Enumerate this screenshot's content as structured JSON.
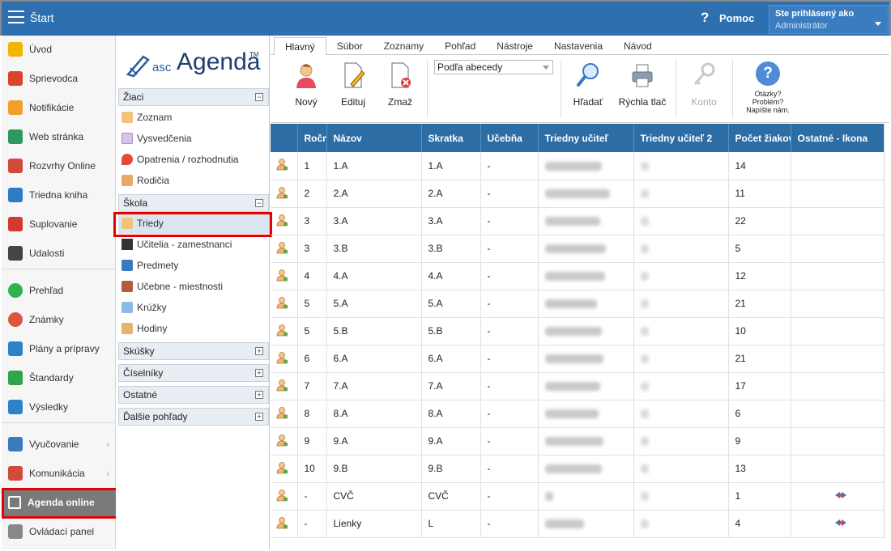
{
  "topbar": {
    "title": "Štart",
    "help_label": "Pomoc",
    "help_icon": "?",
    "user_line1": "Ste prihlásený ako",
    "user_line2": "Administrátor"
  },
  "leftnav": {
    "items": [
      {
        "label": "Úvod",
        "icon": "star-icon",
        "color": "#f2b600"
      },
      {
        "label": "Sprievodca",
        "icon": "wand-icon",
        "color": "#d9442c"
      },
      {
        "label": "Notifikácie",
        "icon": "envelope-icon",
        "color": "#f0a02a"
      },
      {
        "label": "Web stránka",
        "icon": "house-icon",
        "color": "#2c9a5b"
      },
      {
        "label": "Rozvrhy Online",
        "icon": "calendar-icon",
        "color": "#d14a3a"
      },
      {
        "label": "Triedna kniha",
        "icon": "book-icon",
        "color": "#2d7bc4"
      },
      {
        "label": "Suplovanie",
        "icon": "person-icon",
        "color": "#d23a2e"
      },
      {
        "label": "Udalosti",
        "icon": "calendar-grid-icon",
        "color": "#444"
      },
      {
        "label": "Prehľad",
        "icon": "check-circle-icon",
        "color": "#2fb34b"
      },
      {
        "label": "Známky",
        "icon": "grade-circle-icon",
        "color": "#e05540"
      },
      {
        "label": "Plány a prípravy",
        "icon": "briefcase-icon",
        "color": "#2c82c9"
      },
      {
        "label": "Štandardy",
        "icon": "shield-check-icon",
        "color": "#2fa44a"
      },
      {
        "label": "Výsledky",
        "icon": "bar-chart-icon",
        "color": "#2c82c9"
      },
      {
        "label": "Vyučovanie",
        "icon": "open-book-icon",
        "color": "#3a7bc0"
      },
      {
        "label": "Komunikácia",
        "icon": "chat-icon",
        "color": "#d14a3a"
      },
      {
        "label": "Agenda online",
        "icon": "pen-icon",
        "color": "#ffffff"
      },
      {
        "label": "Ovládací panel",
        "icon": "gear-icon",
        "color": "#888"
      }
    ]
  },
  "subnav": {
    "logo_asc": "asc",
    "logo_agenda": "Agenda",
    "logo_tm": "TM",
    "sections": {
      "ziaci": "Žiaci",
      "skola": "Škola",
      "skusky": "Skúšky",
      "ciselniky": "Číselníky",
      "ostatne": "Ostatné",
      "dalsie": "Ďalšie pohľady"
    },
    "ziaci_items": [
      "Zoznam",
      "Vysvedčenia",
      "Opatrenia / rozhodnutia",
      "Rodičia"
    ],
    "skola_items": [
      "Triedy",
      "Učitelia - zamestnanci",
      "Predmety",
      "Učebne - miestnosti",
      "Krúžky",
      "Hodiny"
    ],
    "toggle_minus": "−",
    "toggle_plus": "+"
  },
  "tabs": [
    "Hlavný",
    "Súbor",
    "Zoznamy",
    "Pohľad",
    "Nástroje",
    "Nastavenia",
    "Návod"
  ],
  "ribbon": {
    "new": "Nový",
    "edit": "Edituj",
    "delete": "Zmaž",
    "sort": "Podľa abecedy",
    "search": "Hľadať",
    "print": "Rýchla tlač",
    "account": "Konto",
    "help_line1": "Otázky?",
    "help_line2": "Problém?",
    "help_line3": "Napíšte nám."
  },
  "table": {
    "headers": [
      "",
      "Ročník",
      "Názov",
      "Skratka",
      "Učebňa",
      "Triedny učiteľ",
      "Triedny učiteľ 2",
      "Počet žiakov",
      "Ostatné - Ikona"
    ],
    "rows": [
      {
        "rocnik": "1",
        "nazov": "1.A",
        "skratka": "1.A",
        "ucebna": "-",
        "pocet": "14",
        "other": false
      },
      {
        "rocnik": "2",
        "nazov": "2.A",
        "skratka": "2.A",
        "ucebna": "-",
        "pocet": "11",
        "other": false
      },
      {
        "rocnik": "3",
        "nazov": "3.A",
        "skratka": "3.A",
        "ucebna": "-",
        "pocet": "22",
        "other": false
      },
      {
        "rocnik": "3",
        "nazov": "3.B",
        "skratka": "3.B",
        "ucebna": "-",
        "pocet": "5",
        "other": false
      },
      {
        "rocnik": "4",
        "nazov": "4.A",
        "skratka": "4.A",
        "ucebna": "-",
        "pocet": "12",
        "other": false
      },
      {
        "rocnik": "5",
        "nazov": "5.A",
        "skratka": "5.A",
        "ucebna": "-",
        "pocet": "21",
        "other": false
      },
      {
        "rocnik": "5",
        "nazov": "5.B",
        "skratka": "5.B",
        "ucebna": "-",
        "pocet": "10",
        "other": false
      },
      {
        "rocnik": "6",
        "nazov": "6.A",
        "skratka": "6.A",
        "ucebna": "-",
        "pocet": "21",
        "other": false
      },
      {
        "rocnik": "7",
        "nazov": "7.A",
        "skratka": "7.A",
        "ucebna": "-",
        "pocet": "17",
        "other": false
      },
      {
        "rocnik": "8",
        "nazov": "8.A",
        "skratka": "8.A",
        "ucebna": "-",
        "pocet": "6",
        "other": false
      },
      {
        "rocnik": "9",
        "nazov": "9.A",
        "skratka": "9.A",
        "ucebna": "-",
        "pocet": "9",
        "other": false
      },
      {
        "rocnik": "10",
        "nazov": "9.B",
        "skratka": "9.B",
        "ucebna": "-",
        "pocet": "13",
        "other": false
      },
      {
        "rocnik": "-",
        "nazov": "CVČ",
        "skratka": "CVČ",
        "ucebna": "-",
        "pocet": "1",
        "other": true
      },
      {
        "rocnik": "-",
        "nazov": "Lienky",
        "skratka": "L",
        "ucebna": "-",
        "pocet": "4",
        "other": true
      }
    ]
  },
  "colors": {
    "header_blue": "#2d6da5",
    "topbar_blue": "#2e6fb0",
    "highlight_red": "#e60000"
  }
}
